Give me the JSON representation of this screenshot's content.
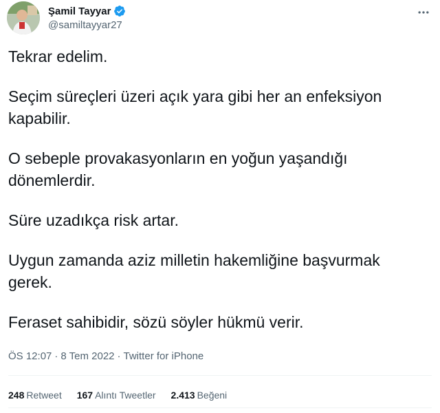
{
  "author": {
    "display_name": "Şamil Tayyar",
    "handle": "@samiltayyar27",
    "verified": true,
    "avatar_icon": "profile-photo"
  },
  "icons": {
    "verified": "verified-badge-icon",
    "more": "more-options-icon"
  },
  "colors": {
    "verified_blue": "#1d9bf0",
    "secondary_text": "#536471",
    "primary_text": "#0f1419"
  },
  "tweet": {
    "paragraphs": [
      "Tekrar edelim.",
      "Seçim süreçleri üzeri açık yara gibi her an enfeksiyon kapabilir.",
      "O sebeple provakasyonların en yoğun yaşandığı dönemlerdir.",
      "Süre uzadıkça risk artar.",
      "Uygun zamanda aziz milletin hakemliğine başvurmak gerek.",
      "Feraset sahibidir, sözü söyler hükmü verir."
    ]
  },
  "meta": {
    "time": "ÖS 12:07",
    "date": "8 Tem 2022",
    "source": "Twitter for iPhone",
    "separator": "·"
  },
  "stats": {
    "retweets": {
      "count": "248",
      "label": "Retweet"
    },
    "quotes": {
      "count": "167",
      "label": "Alıntı Tweetler"
    },
    "likes": {
      "count": "2.413",
      "label": "Beğeni"
    }
  }
}
